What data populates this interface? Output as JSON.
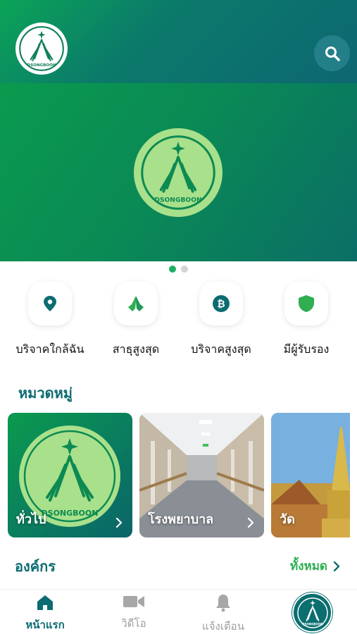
{
  "brand": {
    "logo_text": "DSONGBOON"
  },
  "banner": {
    "slides_total": 2,
    "active_slide": 1
  },
  "quick_actions": [
    {
      "label": "บริจาคใกล้ฉัน",
      "icon": "map-pin-icon"
    },
    {
      "label": "สาธุสูงสุด",
      "icon": "praying-hands-icon"
    },
    {
      "label": "บริจาคสูงสุด",
      "icon": "bitcoin-icon"
    },
    {
      "label": "มีผู้รับรอง",
      "icon": "shield-icon"
    }
  ],
  "categories": {
    "title": "หมวดหมู่",
    "items": [
      {
        "label": "ทั่วไป"
      },
      {
        "label": "โรงพยาบาล"
      },
      {
        "label": "วัด"
      }
    ]
  },
  "organizations": {
    "title": "องค์กร",
    "see_all": "ทั้งหมด"
  },
  "tabbar": {
    "items": [
      {
        "label": "หน้าแรก",
        "icon": "home-icon"
      },
      {
        "label": "วิดีโอ",
        "icon": "video-icon"
      },
      {
        "label": "แจ้งเตือน",
        "icon": "bell-icon"
      }
    ]
  },
  "colors": {
    "primary": "#0c6c72",
    "accent": "#2fae52",
    "logo_green": "#a9e08c"
  }
}
